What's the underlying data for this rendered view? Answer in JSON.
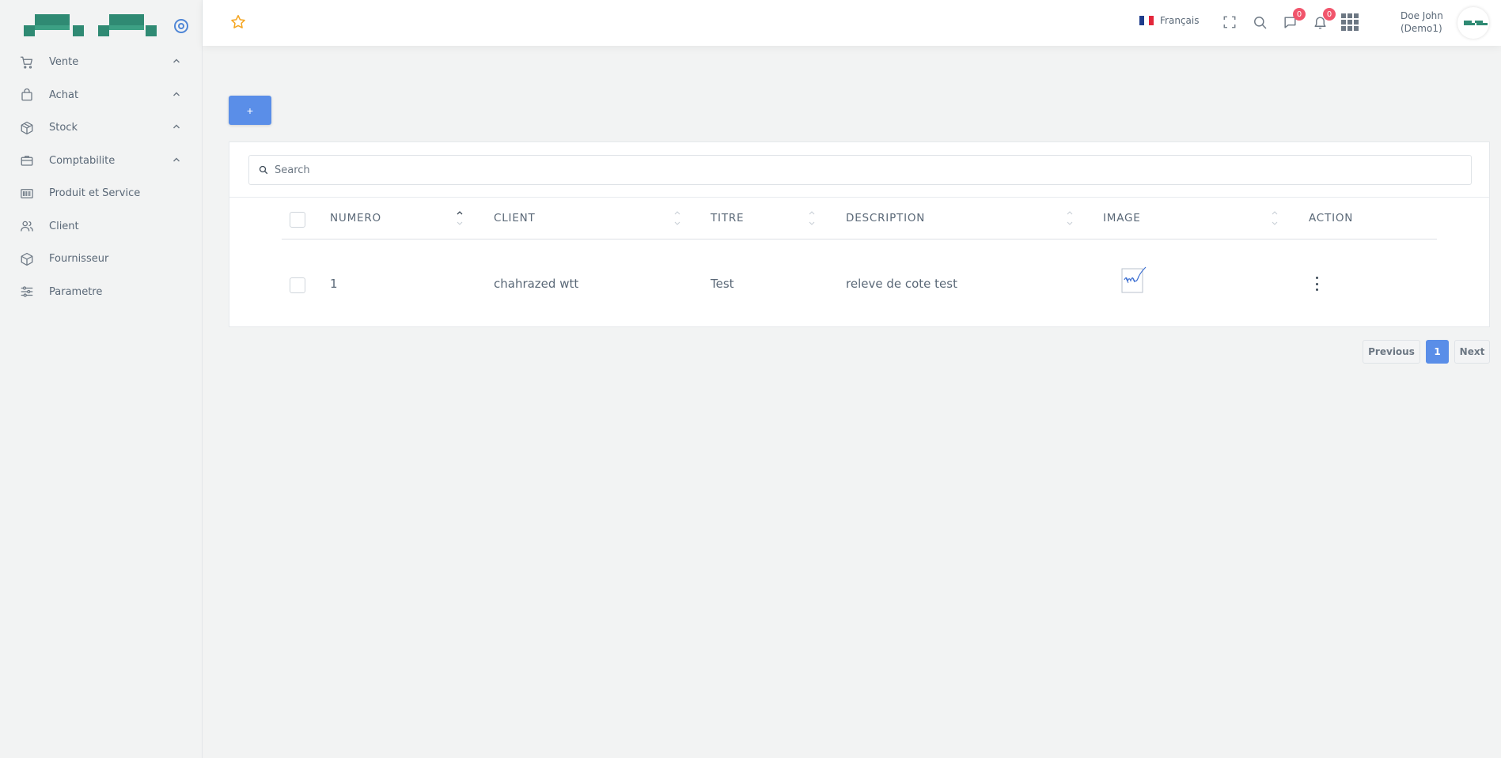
{
  "sidebar": {
    "items": [
      {
        "label": "Vente",
        "icon": "cart-icon",
        "expandable": true
      },
      {
        "label": "Achat",
        "icon": "shopping-bag-icon",
        "expandable": true
      },
      {
        "label": "Stock",
        "icon": "box-icon",
        "expandable": true
      },
      {
        "label": "Comptabilite",
        "icon": "briefcase-icon",
        "expandable": true
      },
      {
        "label": "Produit et Service",
        "icon": "barcode-icon",
        "expandable": false
      },
      {
        "label": "Client",
        "icon": "users-icon",
        "expandable": false
      },
      {
        "label": "Fournisseur",
        "icon": "package-icon",
        "expandable": false
      },
      {
        "label": "Parametre",
        "icon": "sliders-icon",
        "expandable": false
      }
    ]
  },
  "header": {
    "language": "Français",
    "chat_count": "0",
    "notification_count": "0",
    "user_name": "Doe John",
    "user_company": "(Demo1)"
  },
  "toolbar": {
    "add_label": "+"
  },
  "search": {
    "placeholder": "Search"
  },
  "table": {
    "columns": [
      "NUMERO",
      "CLIENT",
      "TITRE",
      "DESCRIPTION",
      "IMAGE",
      "ACTION"
    ],
    "rows": [
      {
        "numero": "1",
        "client": "chahrazed wtt",
        "titre": "Test",
        "description": "releve de cote test"
      }
    ]
  },
  "pagination": {
    "previous": "Previous",
    "current": "1",
    "next": "Next"
  },
  "colors": {
    "accent": "#5a8ee8",
    "badge": "#f1556c",
    "brand": "#2f8a73"
  }
}
